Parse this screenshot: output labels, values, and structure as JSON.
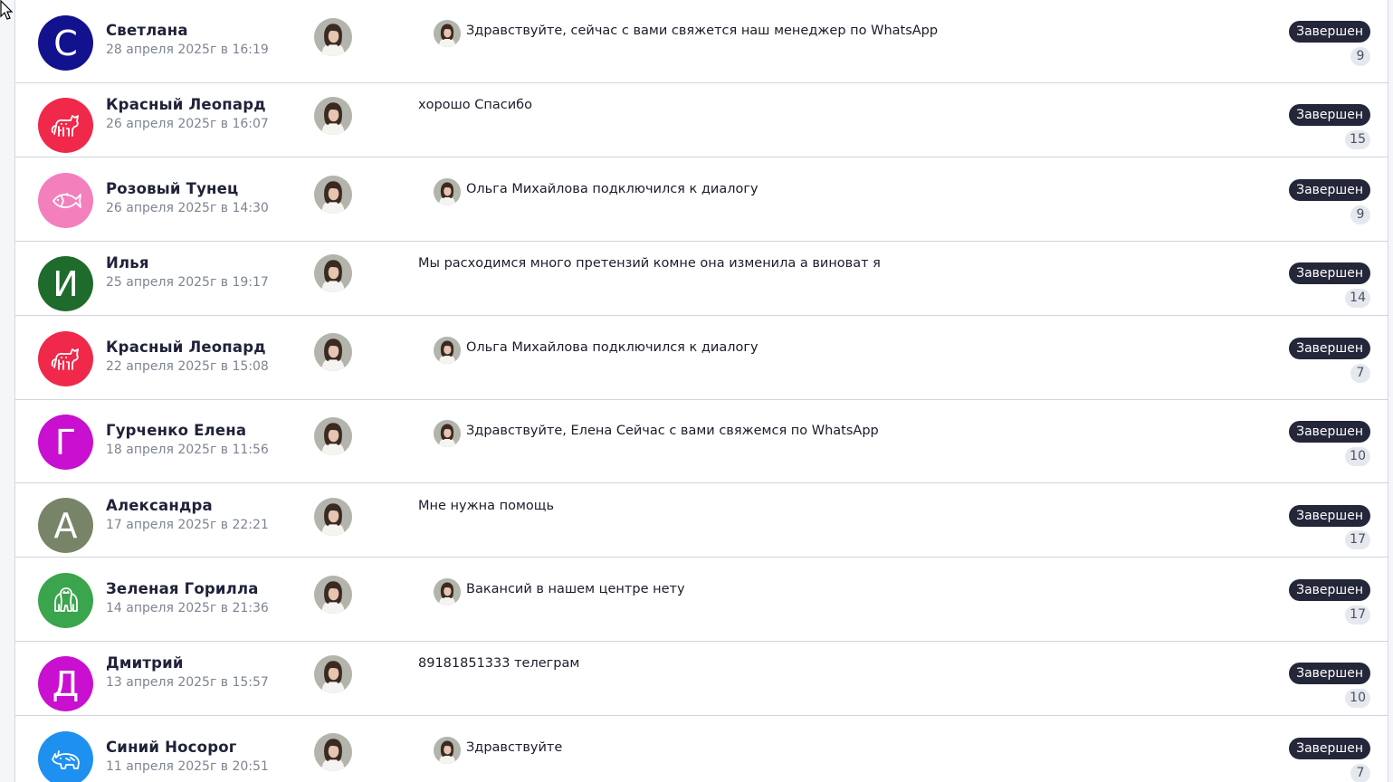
{
  "colors": {
    "status_bg": "#242639",
    "count_bg": "#e5e8ee",
    "date_text": "#7d8590"
  },
  "conversations": [
    {
      "name": "Светлана",
      "date": "28 апреля 2025г в 16:19",
      "avatar_letter": "С",
      "avatar_icon": "",
      "avatar_color": "#12128f",
      "message": "Здравствуйте, сейчас с вами свяжется наш менеджер по WhatsApp",
      "message_has_operator_photo": true,
      "status": "Завершен",
      "count": "9"
    },
    {
      "name": "Красный Леопард",
      "date": "26 апреля 2025г в 16:07",
      "avatar_letter": "",
      "avatar_icon": "leopard-icon",
      "avatar_color": "#f0284a",
      "message": "хорошо Спасибо",
      "message_has_operator_photo": false,
      "status": "Завершен",
      "count": "15"
    },
    {
      "name": "Розовый Тунец",
      "date": "26 апреля 2025г в 14:30",
      "avatar_letter": "",
      "avatar_icon": "tuna-icon",
      "avatar_color": "#f47fbd",
      "message": "Ольга Михайлова подключился к диалогу",
      "message_has_operator_photo": true,
      "status": "Завершен",
      "count": "9"
    },
    {
      "name": "Илья",
      "date": "25 апреля 2025г в 19:17",
      "avatar_letter": "И",
      "avatar_icon": "",
      "avatar_color": "#1e6b2c",
      "message": "Мы расходимся много претензий комне она изменила а виноват я",
      "message_has_operator_photo": false,
      "status": "Завершен",
      "count": "14"
    },
    {
      "name": "Красный Леопард",
      "date": "22 апреля 2025г в 15:08",
      "avatar_letter": "",
      "avatar_icon": "leopard-icon",
      "avatar_color": "#f0284a",
      "message": "Ольга Михайлова подключился к диалогу",
      "message_has_operator_photo": true,
      "status": "Завершен",
      "count": "7"
    },
    {
      "name": "Гурченко Елена",
      "date": "18 апреля 2025г в 11:56",
      "avatar_letter": "Г",
      "avatar_icon": "",
      "avatar_color": "#c90fd0",
      "message": "Здравствуйте, Елена Сейчас с вами свяжемся по WhatsApp",
      "message_has_operator_photo": true,
      "status": "Завершен",
      "count": "10"
    },
    {
      "name": "Александра",
      "date": "17 апреля 2025г в 22:21",
      "avatar_letter": "А",
      "avatar_icon": "",
      "avatar_color": "#788468",
      "message": "Мне нужна помощь",
      "message_has_operator_photo": false,
      "status": "Завершен",
      "count": "17"
    },
    {
      "name": "Зеленая Горилла",
      "date": "14 апреля 2025г в 21:36",
      "avatar_letter": "",
      "avatar_icon": "gorilla-icon",
      "avatar_color": "#3aa54c",
      "message": "Вакансий в нашем центре нету",
      "message_has_operator_photo": true,
      "status": "Завершен",
      "count": "17"
    },
    {
      "name": "Дмитрий",
      "date": "13 апреля 2025г в 15:57",
      "avatar_letter": "Д",
      "avatar_icon": "",
      "avatar_color": "#c90fd0",
      "message": "89181851333 телеграм",
      "message_has_operator_photo": false,
      "status": "Завершен",
      "count": "10"
    },
    {
      "name": "Синий Носорог",
      "date": "11 апреля 2025г в 20:51",
      "avatar_letter": "",
      "avatar_icon": "rhino-icon",
      "avatar_color": "#1e90f0",
      "message": "Здравствуйте",
      "message_has_operator_photo": true,
      "status": "Завершен",
      "count": "7"
    }
  ]
}
